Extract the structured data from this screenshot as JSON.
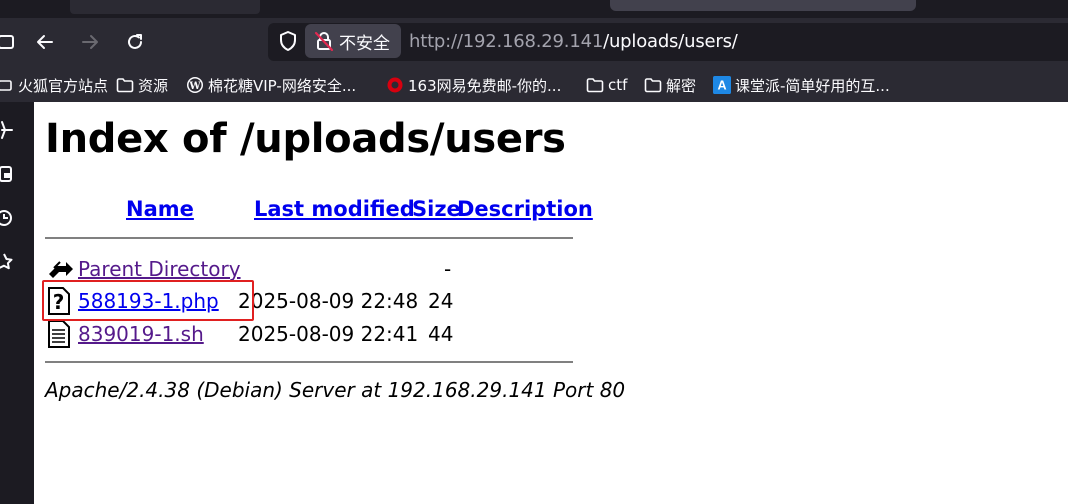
{
  "browser": {
    "security_label": "不安全",
    "url_host": "http://192.168.29.141",
    "url_path": "/uploads/users/"
  },
  "bookmarks": [
    {
      "label": "火狐官方站点",
      "icon": "firefox-icon"
    },
    {
      "label": "资源",
      "icon": "folder-icon"
    },
    {
      "label": "棉花糖VIP-网络安全...",
      "icon": "wordpress-icon"
    },
    {
      "label": "163网易免费邮-你的...",
      "icon": "netease-icon"
    },
    {
      "label": "ctf",
      "icon": "folder-icon"
    },
    {
      "label": "解密",
      "icon": "folder-icon"
    },
    {
      "label": "课堂派-简单好用的互...",
      "icon": "ketangpai-icon"
    }
  ],
  "page": {
    "title": "Index of /uploads/users",
    "columns": {
      "name": "Name",
      "last_modified": "Last modified",
      "size": "Size",
      "description": "Description"
    },
    "parent": {
      "label": "Parent Directory",
      "size": "-"
    },
    "rows": [
      {
        "name": "588193-1.php",
        "modified": "2025-08-09 22:48",
        "size": "24",
        "icon": "unknown-file-icon"
      },
      {
        "name": "839019-1.sh",
        "modified": "2025-08-09 22:41",
        "size": "44",
        "icon": "text-file-icon"
      }
    ],
    "address": "Apache/2.4.38 (Debian) Server at 192.168.29.141 Port 80"
  }
}
